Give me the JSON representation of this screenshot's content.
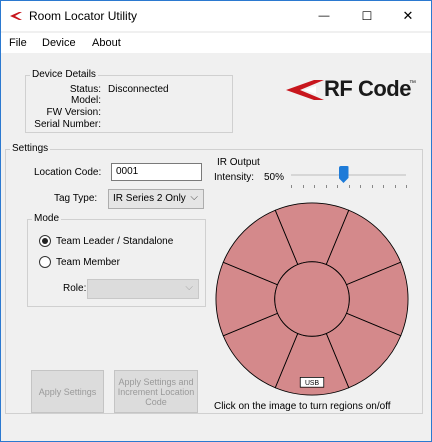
{
  "window": {
    "title": "Room Locator Utility",
    "minimize_glyph": "—",
    "maximize_glyph": "☐",
    "close_glyph": "✕"
  },
  "menu": [
    "File",
    "Device",
    "About"
  ],
  "logo": {
    "text": "RF Code",
    "mark": "™",
    "accent": "#c8161d"
  },
  "device_details": {
    "label": "Device Details",
    "status_label": "Status:",
    "status_value": "Disconnected",
    "model_label": "Model:",
    "model_value": "",
    "fw_label": "FW Version:",
    "fw_value": "",
    "serial_label": "Serial Number:",
    "serial_value": ""
  },
  "settings": {
    "label": "Settings",
    "location_code_label": "Location Code:",
    "location_code_value": "0001",
    "tag_type_label": "Tag Type:",
    "tag_type_value": "IR Series 2 Only",
    "mode": {
      "label": "Mode",
      "options": [
        "Team Leader / Standalone",
        "Team Member"
      ],
      "selected": "Team Leader / Standalone"
    },
    "role_label": "Role:",
    "role_value": "",
    "apply_settings_label": "Apply Settings",
    "apply_increment_label": "Apply Settings and Increment Location Code"
  },
  "ir_output": {
    "label": "IR Output",
    "intensity_label": "Intensity:",
    "intensity_value": "50%",
    "intensity_level": 0.5,
    "region_color": "#d4898b",
    "usb_label": "USB",
    "hint": "Click on the image to turn regions on/off"
  }
}
